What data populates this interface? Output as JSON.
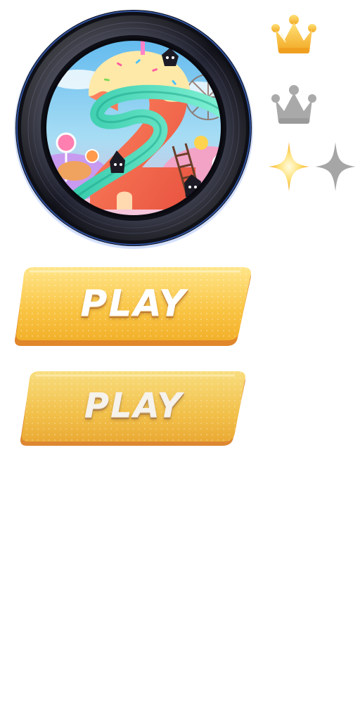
{
  "level_disc": {
    "level_number": "2",
    "colors": {
      "rim": "#1b1d2b",
      "rim_glow": "#5a8cff",
      "sky": "#6ec6f2",
      "number_fill": "#ff6f57",
      "frosting": "#ffe9a8",
      "slide": "#3fd6b8"
    }
  },
  "icons": {
    "crown_gold": "crown-gold-icon",
    "crown_gray": "crown-gray-icon",
    "sparkle_gold": "sparkle-gold-icon",
    "sparkle_gray": "sparkle-gray-icon"
  },
  "buttons": {
    "play_primary": {
      "label": "PLAY"
    },
    "play_secondary": {
      "label": "PLAY"
    }
  },
  "colors": {
    "gold_top": "#ffe27a",
    "gold_bottom": "#f3b52e",
    "button_edge": "#e0862b",
    "gray_icon": "#a9a9a9"
  }
}
